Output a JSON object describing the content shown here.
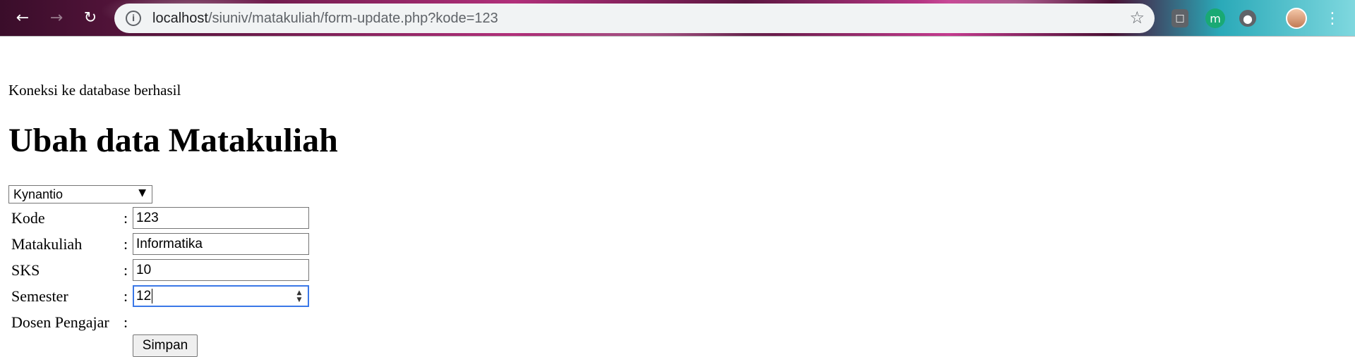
{
  "browser": {
    "url_host": "localhost",
    "url_path": "/siuniv/matakuliah/form-update.php?kode=123",
    "icons": {
      "back": "back-arrow-icon",
      "forward": "forward-arrow-icon",
      "reload": "reload-icon",
      "info": "info-icon",
      "star": "star-icon",
      "shopping": "shopping-bag-icon",
      "ext_m": "m-extension-icon",
      "password": "password-key-icon",
      "avatar": "avatar-icon",
      "menu": "kebab-menu-icon"
    },
    "ext_m_letter": "m"
  },
  "page": {
    "status_text": "Koneksi ke database berhasil",
    "title": "Ubah data Matakuliah",
    "dosen_select": {
      "selected": "Kynantio"
    },
    "form": {
      "kode_label": "Kode",
      "kode_value": "123",
      "matakuliah_label": "Matakuliah",
      "matakuliah_value": "Informatika",
      "sks_label": "SKS",
      "sks_value": "10",
      "semester_label": "Semester",
      "semester_value": "12",
      "dosen_label": "Dosen Pengajar",
      "colon": ":",
      "submit_label": "Simpan"
    }
  },
  "colors": {
    "focus_border": "#3b78e7",
    "omnibox_bg": "#f1f3f4"
  }
}
